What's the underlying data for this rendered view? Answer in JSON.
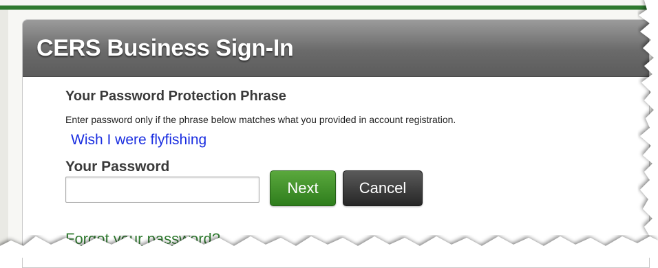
{
  "header": {
    "title": "CERS Business Sign-In"
  },
  "phrase_section": {
    "heading": "Your Password Protection Phrase",
    "instructions": "Enter password only if the phrase below matches what you provided in account registration.",
    "phrase": "Wish I were flyfishing"
  },
  "password_section": {
    "label": "Your Password",
    "value": "",
    "placeholder": ""
  },
  "buttons": {
    "next_label": "Next",
    "cancel_label": "Cancel"
  },
  "links": {
    "forgot_password": "Forgot your password?"
  },
  "colors": {
    "header_gray": "#6a6a6a",
    "next_green": "#2e7d1c",
    "cancel_dark": "#262626",
    "phrase_blue": "#1a2ee0",
    "link_green": "#2f7a2f"
  }
}
